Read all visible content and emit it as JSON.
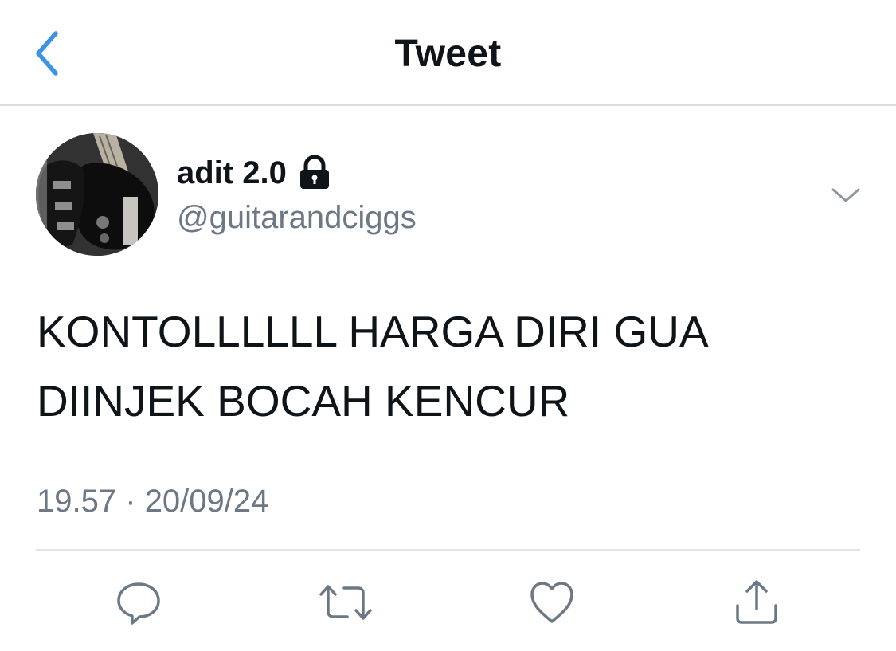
{
  "navbar": {
    "title": "Tweet",
    "back_icon": "chevron-left-icon",
    "accent_color": "#3b94e6"
  },
  "tweet": {
    "author": {
      "display_name": "adit 2.0",
      "handle": "@guitarandciggs",
      "protected_icon": "lock-icon",
      "avatar": "guitar photo"
    },
    "text_lines": [
      "KONTOLLLLLL HARGA DIRI GUA",
      "DIINJEK BOCAH KENCUR"
    ],
    "time": "19.57",
    "separator": "·",
    "date": "20/09/24",
    "more_icon": "chevron-down-icon"
  },
  "actions": [
    {
      "name": "reply",
      "icon": "reply-icon"
    },
    {
      "name": "retweet",
      "icon": "retweet-icon"
    },
    {
      "name": "like",
      "icon": "heart-icon"
    },
    {
      "name": "share",
      "icon": "share-icon"
    }
  ],
  "colors": {
    "text": "#0f1419",
    "secondary_text": "#6c7884",
    "divider": "#dadde0"
  }
}
